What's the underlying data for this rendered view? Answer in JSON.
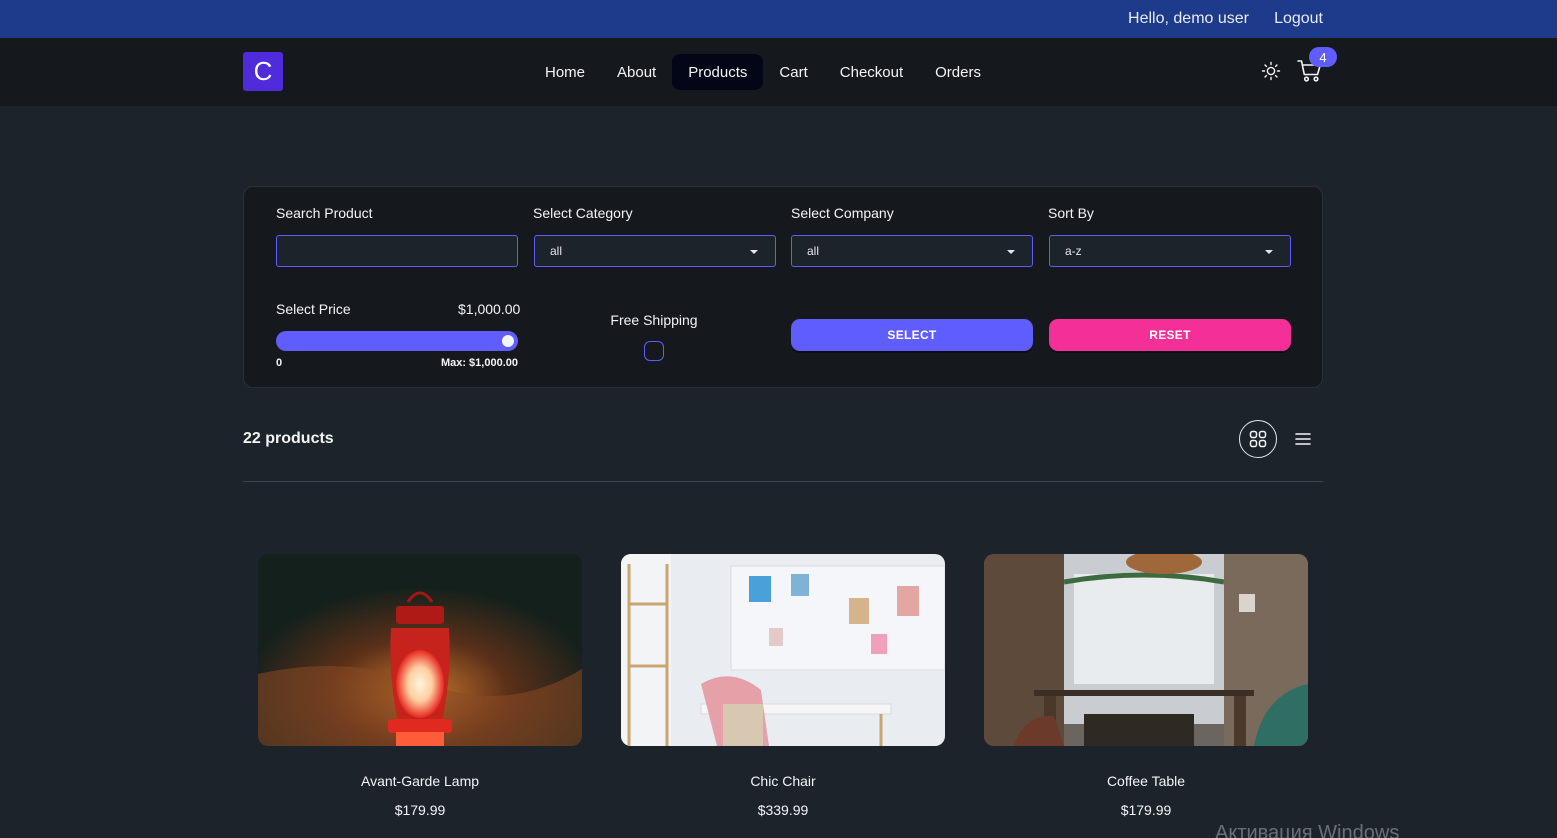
{
  "topbar": {
    "greeting": "Hello, demo user",
    "logout": "Logout"
  },
  "nav": {
    "logo_letter": "C",
    "links": [
      "Home",
      "About",
      "Products",
      "Cart",
      "Checkout",
      "Orders"
    ],
    "active": "Products",
    "cart_count": "4",
    "icons": [
      "sun-icon",
      "cart-icon"
    ]
  },
  "filters": {
    "search_label": "Search Product",
    "search_value": "",
    "category_label": "Select Category",
    "category_value": "all",
    "company_label": "Select Company",
    "company_value": "all",
    "sort_label": "Sort By",
    "sort_value": "a-z",
    "price_label": "Select Price",
    "price_value": "$1,000.00",
    "price_min": "0",
    "price_max": "Max: $1,000.00",
    "price_fill": 1.0,
    "shipping_label": "Free Shipping",
    "shipping_checked": false,
    "select_button": "SELECT",
    "reset_button": "RESET"
  },
  "results": {
    "count": "22 products",
    "view_icons": [
      "grid-icon",
      "list-icon"
    ]
  },
  "products": [
    {
      "name": "Avant-Garde Lamp",
      "price": "$179.99"
    },
    {
      "name": "Chic Chair",
      "price": "$339.99"
    },
    {
      "name": "Coffee Table",
      "price": "$179.99"
    }
  ],
  "watermark": "Активация Windows",
  "colors": {
    "accent": "#605dff",
    "secondary": "#f43098",
    "topbar": "#1e3a8a",
    "navbar": "#15191e",
    "page": "#1d232a"
  }
}
